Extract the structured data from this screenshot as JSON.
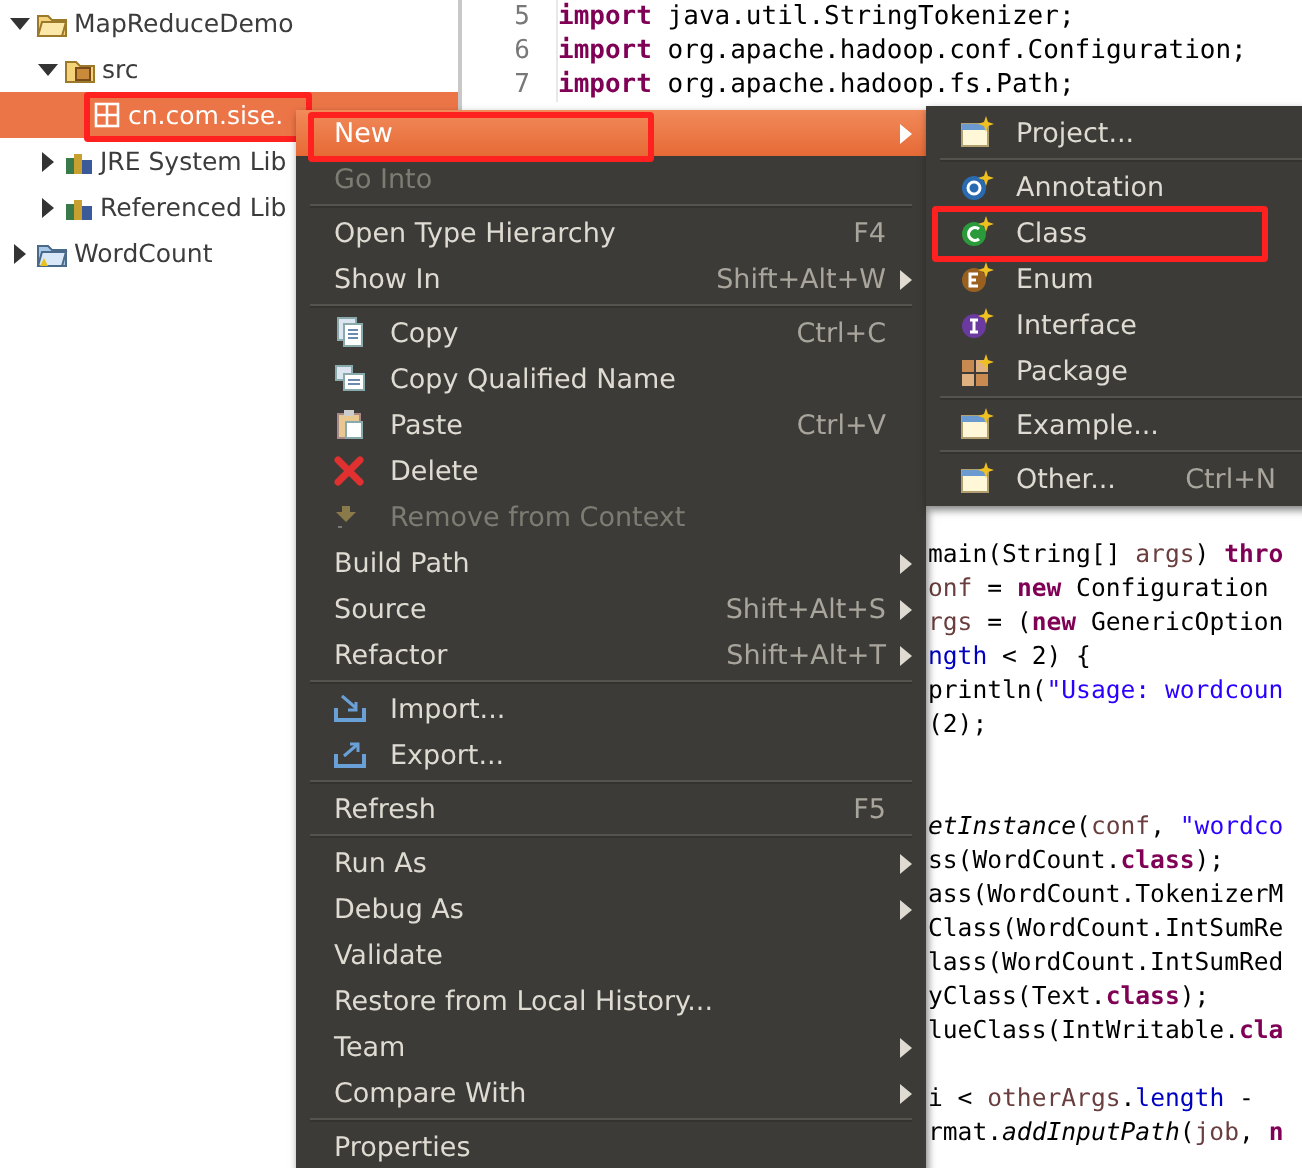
{
  "project_tree": [
    {
      "label": "MapReduceDemo",
      "expanded": true,
      "selected": false,
      "children": [
        {
          "label": "src",
          "expanded": true,
          "selected": false,
          "children": [
            {
              "label": "cn.com.sise.",
              "selected": true,
              "highlighted": true
            }
          ]
        },
        {
          "label": "JRE System Lib",
          "expanded": false,
          "selected": false
        },
        {
          "label": "Referenced Lib",
          "expanded": false,
          "selected": false
        }
      ]
    },
    {
      "label": "WordCount",
      "expanded": false,
      "selected": false
    }
  ],
  "editor": {
    "top_lines": [
      {
        "number": "5",
        "segments": [
          {
            "kind": "kw",
            "text": "import"
          },
          {
            "kind": "plain",
            "text": " java.util.StringTokenizer;"
          }
        ]
      },
      {
        "number": "6",
        "segments": [
          {
            "kind": "kw",
            "text": "import"
          },
          {
            "kind": "plain",
            "text": " org.apache.hadoop.conf.Configuration;"
          }
        ]
      },
      {
        "number": "7",
        "segments": [
          {
            "kind": "kw",
            "text": "import"
          },
          {
            "kind": "plain",
            "text": " org.apache.hadoop.fs.Path;"
          }
        ]
      }
    ],
    "visible_fragments": [
      {
        "kind": "code",
        "segments": [
          {
            "kind": "plain",
            "text": "main(String[] "
          },
          {
            "kind": "var",
            "text": "args"
          },
          {
            "kind": "plain",
            "text": ") "
          },
          {
            "kind": "kw",
            "text": "thro"
          }
        ]
      },
      {
        "kind": "code",
        "segments": [
          {
            "kind": "var",
            "text": "onf"
          },
          {
            "kind": "plain",
            "text": " = "
          },
          {
            "kind": "kw",
            "text": "new"
          },
          {
            "kind": "plain",
            "text": " Configuration"
          }
        ]
      },
      {
        "kind": "code",
        "segments": [
          {
            "kind": "var",
            "text": "rgs"
          },
          {
            "kind": "plain",
            "text": " = ("
          },
          {
            "kind": "kw",
            "text": "new"
          },
          {
            "kind": "plain",
            "text": " GenericOption"
          }
        ]
      },
      {
        "kind": "code",
        "segments": [
          {
            "kind": "field",
            "text": "ngth"
          },
          {
            "kind": "plain",
            "text": " < 2) {"
          }
        ]
      },
      {
        "kind": "code",
        "segments": [
          {
            "kind": "plain",
            "text": "println("
          },
          {
            "kind": "str",
            "text": "\"Usage: wordcoun"
          }
        ]
      },
      {
        "kind": "code",
        "segments": [
          {
            "kind": "plain",
            "text": "(2);"
          }
        ]
      },
      {
        "kind": "blank"
      },
      {
        "kind": "blank"
      },
      {
        "kind": "code",
        "segments": [
          {
            "kind": "static",
            "text": "etInstance"
          },
          {
            "kind": "plain",
            "text": "("
          },
          {
            "kind": "var",
            "text": "conf"
          },
          {
            "kind": "plain",
            "text": ", "
          },
          {
            "kind": "str",
            "text": "\"wordco"
          }
        ]
      },
      {
        "kind": "code",
        "segments": [
          {
            "kind": "plain",
            "text": "ss(WordCount."
          },
          {
            "kind": "kw",
            "text": "class"
          },
          {
            "kind": "plain",
            "text": ");"
          }
        ]
      },
      {
        "kind": "code",
        "segments": [
          {
            "kind": "plain",
            "text": "ass(WordCount.TokenizerM"
          }
        ]
      },
      {
        "kind": "code",
        "segments": [
          {
            "kind": "plain",
            "text": "Class(WordCount.IntSumRe"
          }
        ]
      },
      {
        "kind": "code",
        "segments": [
          {
            "kind": "plain",
            "text": "lass(WordCount.IntSumRed"
          }
        ]
      },
      {
        "kind": "code",
        "segments": [
          {
            "kind": "plain",
            "text": "yClass(Text."
          },
          {
            "kind": "kw",
            "text": "class"
          },
          {
            "kind": "plain",
            "text": ");"
          }
        ]
      },
      {
        "kind": "code",
        "segments": [
          {
            "kind": "plain",
            "text": "lueClass(IntWritable."
          },
          {
            "kind": "kw",
            "text": "cla"
          }
        ]
      },
      {
        "kind": "blank"
      },
      {
        "kind": "code",
        "segments": [
          {
            "kind": "plain",
            "text": "i < "
          },
          {
            "kind": "var",
            "text": "otherArgs"
          },
          {
            "kind": "plain",
            "text": "."
          },
          {
            "kind": "field",
            "text": "length"
          },
          {
            "kind": "plain",
            "text": " -"
          }
        ]
      },
      {
        "kind": "code",
        "segments": [
          {
            "kind": "plain",
            "text": "rmat."
          },
          {
            "kind": "static",
            "text": "addInputPath"
          },
          {
            "kind": "plain",
            "text": "("
          },
          {
            "kind": "var",
            "text": "job"
          },
          {
            "kind": "plain",
            "text": ", "
          },
          {
            "kind": "kw",
            "text": "n"
          }
        ]
      }
    ]
  },
  "context_menu": {
    "items": [
      {
        "kind": "item",
        "label": "New",
        "selected": true,
        "disabled": false,
        "submenu": true,
        "highlighted": true
      },
      {
        "kind": "item",
        "label": "Go Into",
        "selected": false,
        "disabled": true,
        "submenu": false
      },
      {
        "kind": "separator"
      },
      {
        "kind": "item",
        "label": "Open Type Hierarchy",
        "shortcut": "F4",
        "selected": false,
        "disabled": false,
        "submenu": false
      },
      {
        "kind": "item",
        "label": "Show In",
        "shortcut": "Shift+Alt+W",
        "selected": false,
        "disabled": false,
        "submenu": true
      },
      {
        "kind": "separator"
      },
      {
        "kind": "item",
        "label": "Copy",
        "shortcut": "Ctrl+C",
        "selected": false,
        "disabled": false,
        "submenu": false
      },
      {
        "kind": "item",
        "label": "Copy Qualified Name",
        "selected": false,
        "disabled": false,
        "submenu": false
      },
      {
        "kind": "item",
        "label": "Paste",
        "shortcut": "Ctrl+V",
        "selected": false,
        "disabled": false,
        "submenu": false
      },
      {
        "kind": "item",
        "label": "Delete",
        "selected": false,
        "disabled": false,
        "submenu": false
      },
      {
        "kind": "item",
        "label": "Remove from Context",
        "selected": false,
        "disabled": true,
        "submenu": false
      },
      {
        "kind": "item",
        "label": "Build Path",
        "selected": false,
        "disabled": false,
        "submenu": true
      },
      {
        "kind": "item",
        "label": "Source",
        "shortcut": "Shift+Alt+S",
        "selected": false,
        "disabled": false,
        "submenu": true
      },
      {
        "kind": "item",
        "label": "Refactor",
        "shortcut": "Shift+Alt+T",
        "selected": false,
        "disabled": false,
        "submenu": true
      },
      {
        "kind": "separator"
      },
      {
        "kind": "item",
        "label": "Import...",
        "selected": false,
        "disabled": false,
        "submenu": false
      },
      {
        "kind": "item",
        "label": "Export...",
        "selected": false,
        "disabled": false,
        "submenu": false
      },
      {
        "kind": "separator"
      },
      {
        "kind": "item",
        "label": "Refresh",
        "shortcut": "F5",
        "selected": false,
        "disabled": false,
        "submenu": false
      },
      {
        "kind": "separator"
      },
      {
        "kind": "item",
        "label": "Run As",
        "selected": false,
        "disabled": false,
        "submenu": true
      },
      {
        "kind": "item",
        "label": "Debug As",
        "selected": false,
        "disabled": false,
        "submenu": true
      },
      {
        "kind": "item",
        "label": "Validate",
        "selected": false,
        "disabled": false,
        "submenu": false
      },
      {
        "kind": "item",
        "label": "Restore from Local History...",
        "selected": false,
        "disabled": false,
        "submenu": false
      },
      {
        "kind": "item",
        "label": "Team",
        "selected": false,
        "disabled": false,
        "submenu": true
      },
      {
        "kind": "item",
        "label": "Compare With",
        "selected": false,
        "disabled": false,
        "submenu": true
      },
      {
        "kind": "separator"
      },
      {
        "kind": "item",
        "label": "Properties",
        "selected": false,
        "disabled": false,
        "submenu": false
      }
    ]
  },
  "new_submenu": {
    "items": [
      {
        "kind": "item",
        "label": "Project...",
        "selected": false
      },
      {
        "kind": "separator"
      },
      {
        "kind": "item",
        "label": "Annotation",
        "selected": false
      },
      {
        "kind": "item",
        "label": "Class",
        "selected": false,
        "highlighted": true
      },
      {
        "kind": "item",
        "label": "Enum",
        "selected": false
      },
      {
        "kind": "item",
        "label": "Interface",
        "selected": false
      },
      {
        "kind": "item",
        "label": "Package",
        "selected": false
      },
      {
        "kind": "separator"
      },
      {
        "kind": "item",
        "label": "Example...",
        "selected": false
      },
      {
        "kind": "separator"
      },
      {
        "kind": "item",
        "label": "Other...",
        "shortcut": "Ctrl+N",
        "selected": false
      }
    ]
  }
}
